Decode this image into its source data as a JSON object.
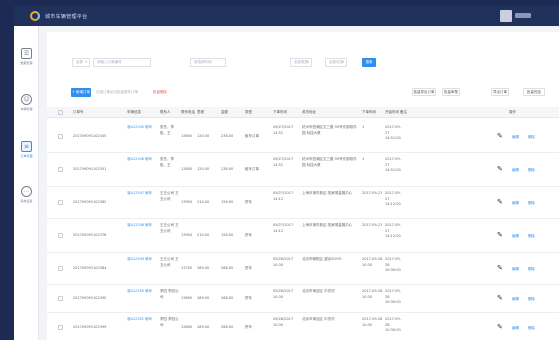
{
  "app": {
    "title": "城市车辆管理平台"
  },
  "sidebar": {
    "items": [
      {
        "icon": "list-icon",
        "glyph": "☰",
        "label": "数据管理",
        "active": false
      },
      {
        "icon": "person-icon",
        "glyph": "☺",
        "label": "车辆管理",
        "active": false
      },
      {
        "icon": "document-icon",
        "glyph": "≡",
        "label": "订单管理",
        "active": true
      },
      {
        "icon": "dots-icon",
        "glyph": "⋯",
        "label": "系统设置",
        "active": false
      }
    ]
  },
  "filters": {
    "select1": "全部",
    "input1": "请输入订单编号",
    "input2": "请选择时间",
    "select2": "全部类型",
    "select3": "全部状态",
    "search_label": "搜索"
  },
  "actions": {
    "add_label": "+ 新增订单",
    "check_label": "勾选订单后可批量操作订单",
    "delete_label": "批量删除",
    "right_buttons": [
      "批量导出订单",
      "批量审核",
      "导出订单",
      "批量完结"
    ]
  },
  "table": {
    "columns": [
      "订单号",
      "车辆信息",
      "联系人",
      "联系电话",
      "里程",
      "金额",
      "类型",
      "下单时间",
      "收货地址",
      "下单时间",
      "开始时间",
      "备注",
      "操作"
    ],
    "rows": [
      {
        "order": "201709091102345",
        "vehicle": "浙A12345 轿车",
        "contact": "张先、李俊、王",
        "phone": "13800",
        "mileage": "120.00",
        "amount": "238.00",
        "type": "租车订单",
        "time": "09/27/2017 14:51",
        "address": "杭州市西湖区文三路 90号东部软件园 科技大厦",
        "order_time": "1",
        "start": "2017-09-27 14:51:00",
        "ops": [
          "编辑",
          "删除"
        ]
      },
      {
        "order": "201709091102351",
        "vehicle": "浙A12346 轿车",
        "contact": "张先、李俊、王",
        "phone": "13800",
        "mileage": "120.00",
        "amount": "238.00",
        "type": "租车订单",
        "time": "09/27/2017 14:51",
        "address": "杭州市西湖区文三路 90号东部软件园 科技大厦",
        "order_time": "1",
        "start": "2017-09-27 14:51:00",
        "ops": [
          "编辑",
          "删除"
        ]
      },
      {
        "order": "201709091102362",
        "vehicle": "浙A12347 轿车",
        "contact": "王五公司 王五公司",
        "phone": "13900",
        "mileage": "210.00",
        "amount": "156.00",
        "type": "拼车",
        "time": "09/27/2017 14:12",
        "address": "上海市浦东新区 陆家嘴金融中心",
        "order_time": "2017-09-27",
        "start": "2017-09-27 14:12:00",
        "ops": [
          "编辑",
          "删除"
        ]
      },
      {
        "order": "201709091102378",
        "vehicle": "浙A12348 轿车",
        "contact": "王五公司 王五公司",
        "phone": "13900",
        "mileage": "210.00",
        "amount": "156.00",
        "type": "拼车",
        "time": "09/27/2017 14:12",
        "address": "上海市浦东新区 陆家嘴金融中心",
        "order_time": "2017-09-27",
        "start": "2017-09-27 14:12:00",
        "ops": [
          "编辑",
          "删除"
        ]
      },
      {
        "order": "201709091102384",
        "vehicle": "浙A12349 轿车",
        "contact": "王五公司 王五公司",
        "phone": "13700",
        "mileage": "189.00",
        "amount": "268.00",
        "type": "拼车",
        "time": "09/28/2017 10:30",
        "address": "北京市朝阳区 望京SOHO",
        "order_time": "2017-09-28 10:30",
        "start": "2017-09-28 10:30:00",
        "ops": [
          "编辑",
          "删除"
        ]
      },
      {
        "order": "201709091102390",
        "vehicle": "浙A12350 轿车",
        "contact": "李四 李四公司",
        "phone": "13600",
        "mileage": "189.00",
        "amount": "268.00",
        "type": "拼车",
        "time": "09/28/2017 10:30",
        "address": "北京市海淀区 中关村",
        "order_time": "2017-09-28 10:30",
        "start": "2017-09-28 10:30:00",
        "ops": [
          "编辑",
          "删除"
        ]
      },
      {
        "order": "201709091102399",
        "vehicle": "浙A12351 轿车",
        "contact": "李四 李四公司",
        "phone": "13600",
        "mileage": "189.00",
        "amount": "268.00",
        "type": "拼车",
        "time": "09/28/2017 10:30",
        "address": "北京市海淀区 中关村",
        "order_time": "2017-09-28 10:30",
        "start": "2017-09-28 10:30:00",
        "ops": [
          "编辑",
          "删除"
        ]
      }
    ]
  },
  "colors": {
    "topbar": "#20315c",
    "accent": "#2d8ff0",
    "danger": "#e35a5a",
    "frame": "#1c2a54"
  }
}
